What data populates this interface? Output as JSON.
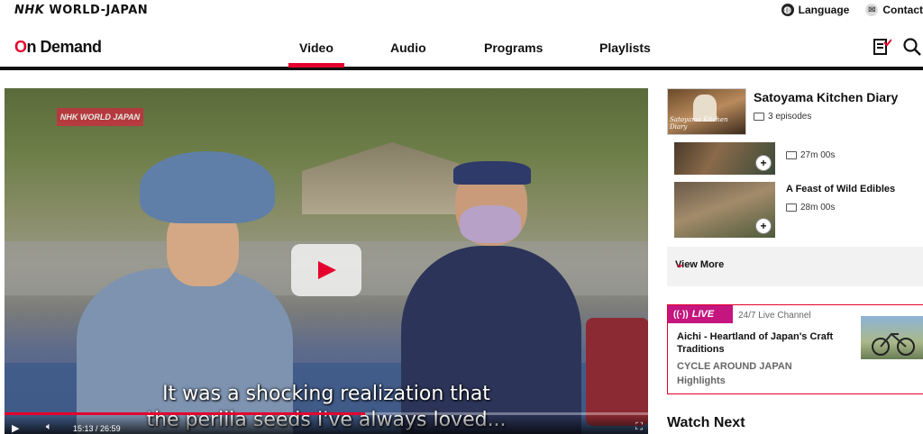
{
  "topbar": {
    "brand_nhk": "NHK",
    "brand_rest": "WORLD-JAPAN",
    "language_label": "Language",
    "contact_label": "Contact"
  },
  "nav": {
    "logo_o": "O",
    "logo_rest": "n Demand",
    "tabs": [
      {
        "label": "Video",
        "active": true
      },
      {
        "label": "Audio",
        "active": false
      },
      {
        "label": "Programs",
        "active": false
      },
      {
        "label": "Playlists",
        "active": false
      }
    ],
    "icons": [
      "playlist-check-icon",
      "search-icon"
    ]
  },
  "player": {
    "watermark": "NHK WORLD JAPAN",
    "subtitle_line1": "It was a shocking realization that",
    "subtitle_line2": "the perilla seeds I've always loved...",
    "time_current": "15:13",
    "time_total": "26:59",
    "progress": 0.56,
    "accent_color": "#e5002d"
  },
  "series": {
    "title": "Satoyama Kitchen Diary",
    "thumb_caption": "Satoyama Kitchen Diary",
    "episodes_count": "3 episodes",
    "episodes": [
      {
        "title": "",
        "duration": "27m 00s"
      },
      {
        "title": "A Feast of Wild Edibles",
        "duration": "28m 00s"
      }
    ],
    "view_more": "View More"
  },
  "live": {
    "badge": "LIVE",
    "channel": "24/7 Live Channel",
    "title": "Aichi - Heartland of Japan's Craft Traditions",
    "series": "CYCLE AROUND JAPAN",
    "subtitle": "Highlights",
    "badge_color": "#c5157f"
  },
  "watch_next": "Watch Next"
}
